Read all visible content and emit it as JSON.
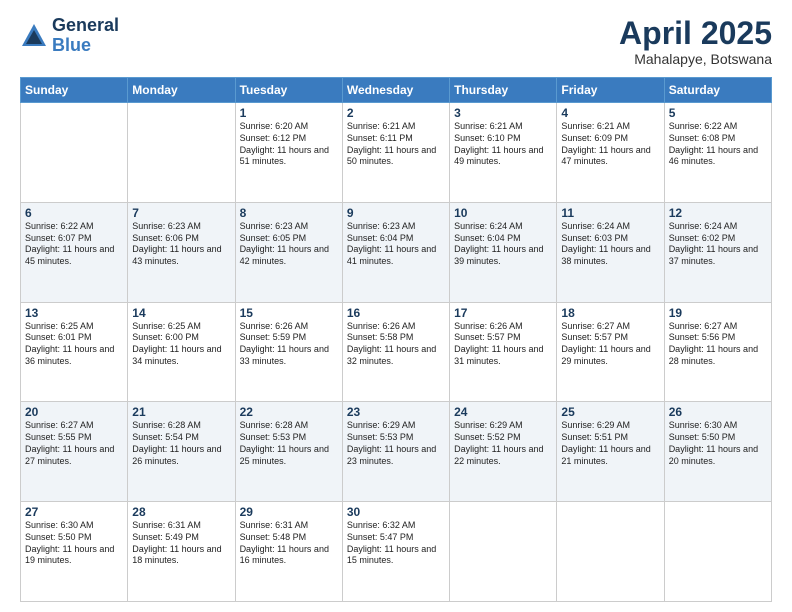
{
  "logo": {
    "general": "General",
    "blue": "Blue"
  },
  "title": "April 2025",
  "subtitle": "Mahalapye, Botswana",
  "headers": [
    "Sunday",
    "Monday",
    "Tuesday",
    "Wednesday",
    "Thursday",
    "Friday",
    "Saturday"
  ],
  "weeks": [
    [
      {
        "day": "",
        "info": ""
      },
      {
        "day": "",
        "info": ""
      },
      {
        "day": "1",
        "info": "Sunrise: 6:20 AM\nSunset: 6:12 PM\nDaylight: 11 hours and 51 minutes."
      },
      {
        "day": "2",
        "info": "Sunrise: 6:21 AM\nSunset: 6:11 PM\nDaylight: 11 hours and 50 minutes."
      },
      {
        "day": "3",
        "info": "Sunrise: 6:21 AM\nSunset: 6:10 PM\nDaylight: 11 hours and 49 minutes."
      },
      {
        "day": "4",
        "info": "Sunrise: 6:21 AM\nSunset: 6:09 PM\nDaylight: 11 hours and 47 minutes."
      },
      {
        "day": "5",
        "info": "Sunrise: 6:22 AM\nSunset: 6:08 PM\nDaylight: 11 hours and 46 minutes."
      }
    ],
    [
      {
        "day": "6",
        "info": "Sunrise: 6:22 AM\nSunset: 6:07 PM\nDaylight: 11 hours and 45 minutes."
      },
      {
        "day": "7",
        "info": "Sunrise: 6:23 AM\nSunset: 6:06 PM\nDaylight: 11 hours and 43 minutes."
      },
      {
        "day": "8",
        "info": "Sunrise: 6:23 AM\nSunset: 6:05 PM\nDaylight: 11 hours and 42 minutes."
      },
      {
        "day": "9",
        "info": "Sunrise: 6:23 AM\nSunset: 6:04 PM\nDaylight: 11 hours and 41 minutes."
      },
      {
        "day": "10",
        "info": "Sunrise: 6:24 AM\nSunset: 6:04 PM\nDaylight: 11 hours and 39 minutes."
      },
      {
        "day": "11",
        "info": "Sunrise: 6:24 AM\nSunset: 6:03 PM\nDaylight: 11 hours and 38 minutes."
      },
      {
        "day": "12",
        "info": "Sunrise: 6:24 AM\nSunset: 6:02 PM\nDaylight: 11 hours and 37 minutes."
      }
    ],
    [
      {
        "day": "13",
        "info": "Sunrise: 6:25 AM\nSunset: 6:01 PM\nDaylight: 11 hours and 36 minutes."
      },
      {
        "day": "14",
        "info": "Sunrise: 6:25 AM\nSunset: 6:00 PM\nDaylight: 11 hours and 34 minutes."
      },
      {
        "day": "15",
        "info": "Sunrise: 6:26 AM\nSunset: 5:59 PM\nDaylight: 11 hours and 33 minutes."
      },
      {
        "day": "16",
        "info": "Sunrise: 6:26 AM\nSunset: 5:58 PM\nDaylight: 11 hours and 32 minutes."
      },
      {
        "day": "17",
        "info": "Sunrise: 6:26 AM\nSunset: 5:57 PM\nDaylight: 11 hours and 31 minutes."
      },
      {
        "day": "18",
        "info": "Sunrise: 6:27 AM\nSunset: 5:57 PM\nDaylight: 11 hours and 29 minutes."
      },
      {
        "day": "19",
        "info": "Sunrise: 6:27 AM\nSunset: 5:56 PM\nDaylight: 11 hours and 28 minutes."
      }
    ],
    [
      {
        "day": "20",
        "info": "Sunrise: 6:27 AM\nSunset: 5:55 PM\nDaylight: 11 hours and 27 minutes."
      },
      {
        "day": "21",
        "info": "Sunrise: 6:28 AM\nSunset: 5:54 PM\nDaylight: 11 hours and 26 minutes."
      },
      {
        "day": "22",
        "info": "Sunrise: 6:28 AM\nSunset: 5:53 PM\nDaylight: 11 hours and 25 minutes."
      },
      {
        "day": "23",
        "info": "Sunrise: 6:29 AM\nSunset: 5:53 PM\nDaylight: 11 hours and 23 minutes."
      },
      {
        "day": "24",
        "info": "Sunrise: 6:29 AM\nSunset: 5:52 PM\nDaylight: 11 hours and 22 minutes."
      },
      {
        "day": "25",
        "info": "Sunrise: 6:29 AM\nSunset: 5:51 PM\nDaylight: 11 hours and 21 minutes."
      },
      {
        "day": "26",
        "info": "Sunrise: 6:30 AM\nSunset: 5:50 PM\nDaylight: 11 hours and 20 minutes."
      }
    ],
    [
      {
        "day": "27",
        "info": "Sunrise: 6:30 AM\nSunset: 5:50 PM\nDaylight: 11 hours and 19 minutes."
      },
      {
        "day": "28",
        "info": "Sunrise: 6:31 AM\nSunset: 5:49 PM\nDaylight: 11 hours and 18 minutes."
      },
      {
        "day": "29",
        "info": "Sunrise: 6:31 AM\nSunset: 5:48 PM\nDaylight: 11 hours and 16 minutes."
      },
      {
        "day": "30",
        "info": "Sunrise: 6:32 AM\nSunset: 5:47 PM\nDaylight: 11 hours and 15 minutes."
      },
      {
        "day": "",
        "info": ""
      },
      {
        "day": "",
        "info": ""
      },
      {
        "day": "",
        "info": ""
      }
    ]
  ]
}
